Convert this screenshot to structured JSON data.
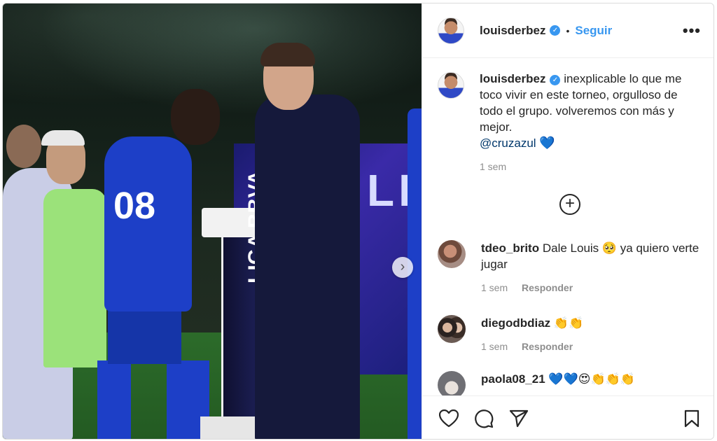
{
  "post": {
    "username": "louisderbez",
    "follow_label": "Seguir",
    "more_glyph": "•••",
    "separator": "•",
    "verified_glyph": "✓",
    "carousel_next_glyph": "›",
    "photo_texts": {
      "jersey_number": "08",
      "banner": "LIG",
      "podium": "LIGA BBVA"
    }
  },
  "caption": {
    "username": "louisderbez",
    "text": "inexplicable lo que me toco vivir en este torneo, orgulloso de todo el grupo. volveremos con más y mejor.",
    "mention": "@cruzazul",
    "emoji": "💙",
    "time": "1 sem"
  },
  "load_more_glyph": "+",
  "comments": [
    {
      "username": "tdeo_brito",
      "text": "Dale Louis 🥺 ya quiero verte jugar",
      "time": "1 sem",
      "reply_label": "Responder"
    },
    {
      "username": "diegodbdiaz",
      "text": "👏👏",
      "time": "1 sem",
      "reply_label": "Responder"
    },
    {
      "username": "paola08_21",
      "text": "💙💙😍👏👏👏"
    }
  ],
  "icons": {
    "like": "heart-outline",
    "comment": "speech-bubble",
    "share": "paper-plane",
    "save": "bookmark"
  },
  "colors": {
    "link": "#3897f0",
    "mention": "#00376b",
    "muted": "#8e8e8e",
    "text": "#262626"
  }
}
